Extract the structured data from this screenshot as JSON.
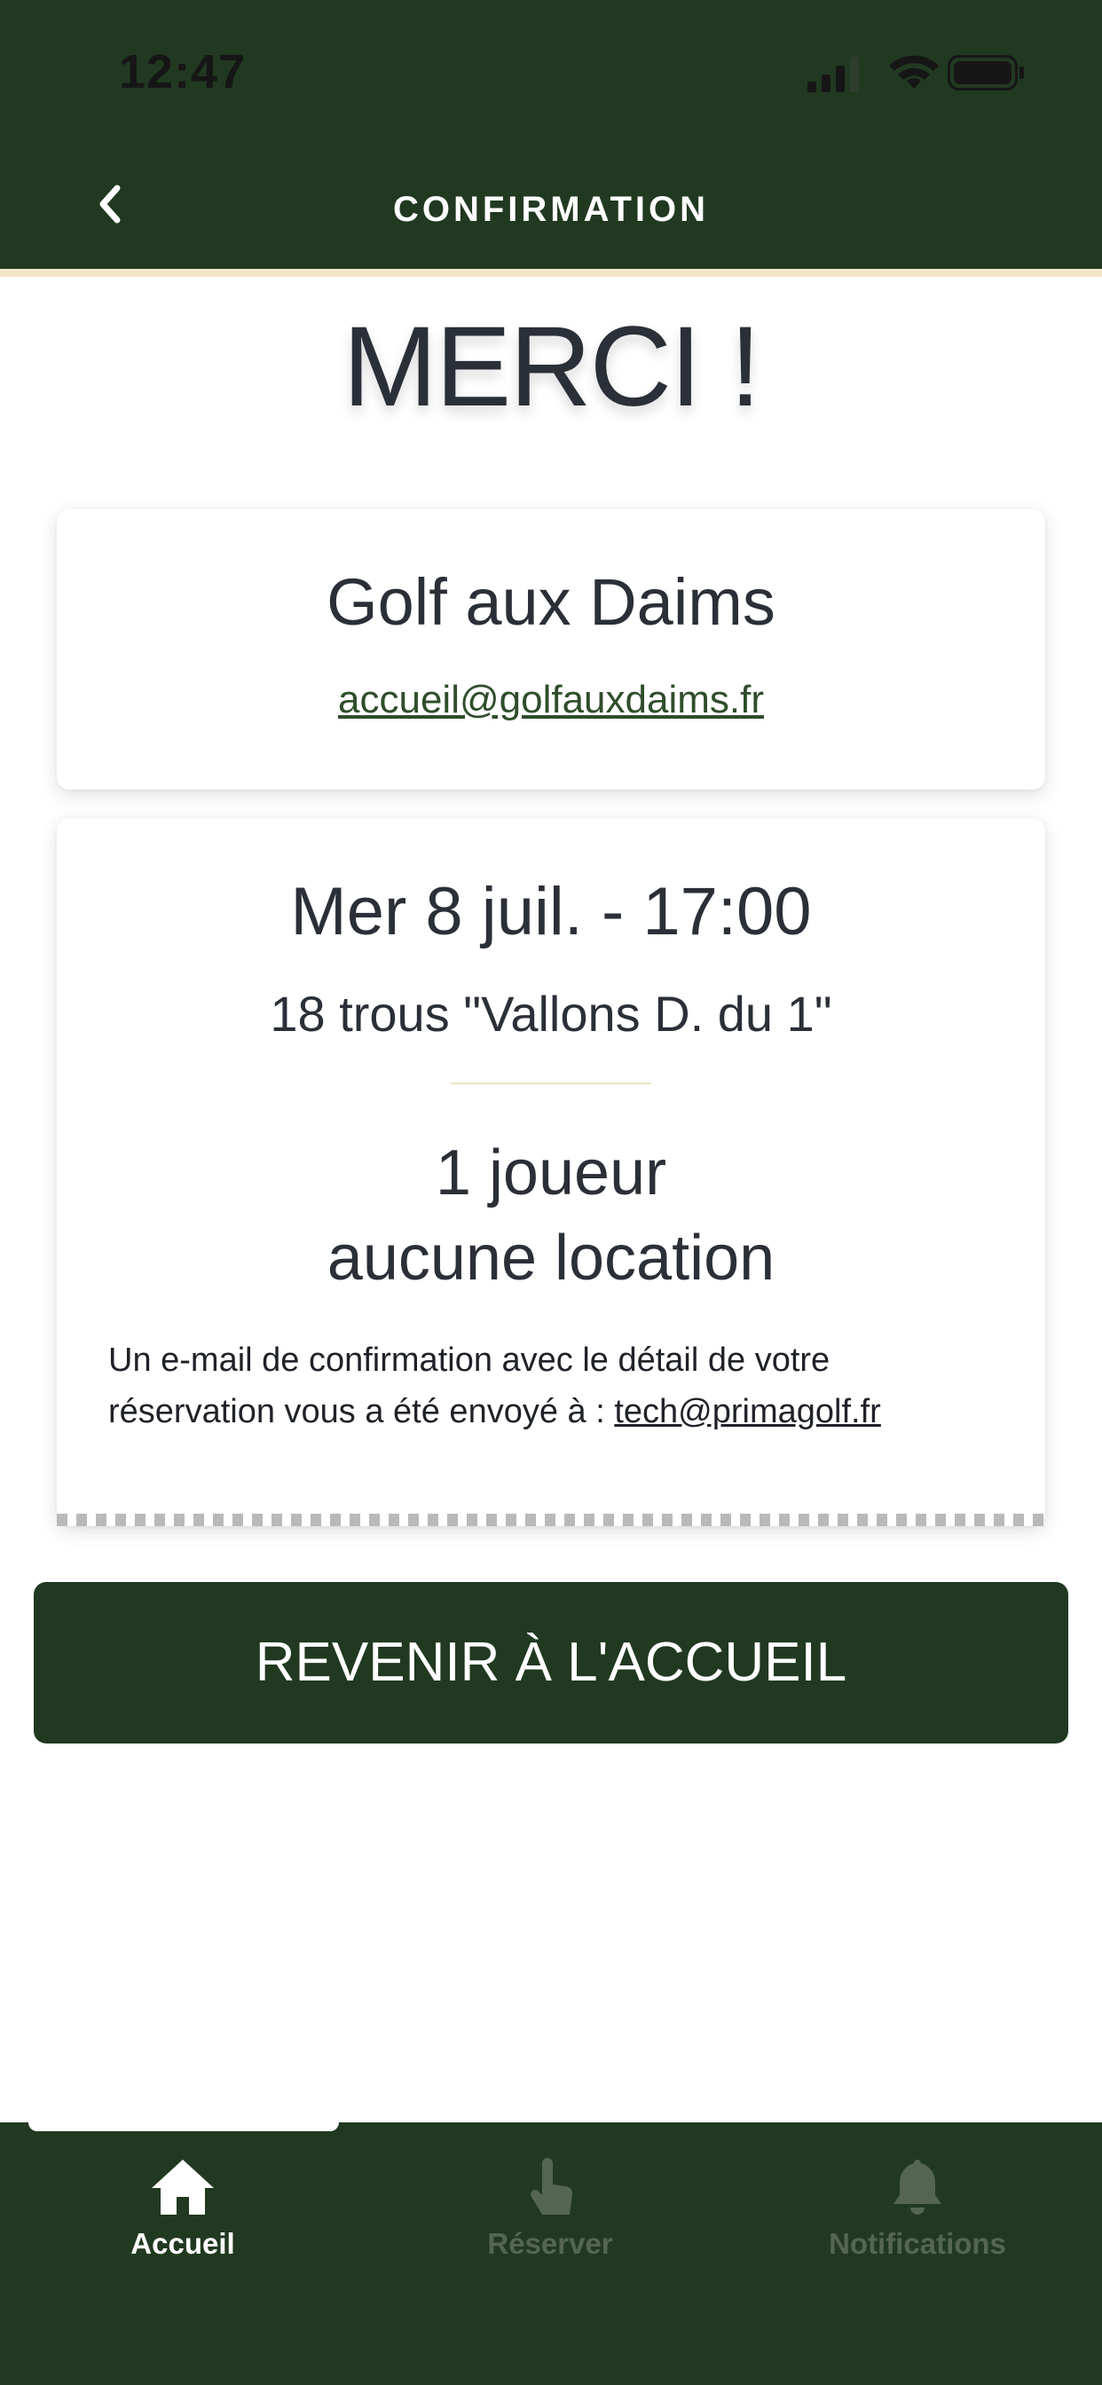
{
  "status_bar": {
    "time": "12:47",
    "icons": [
      "signal-icon",
      "wifi-icon",
      "battery-icon"
    ]
  },
  "header": {
    "back_icon": "chevron-left-icon",
    "title": "CONFIRMATION"
  },
  "main": {
    "thanks": "MERCI !",
    "club": {
      "name": "Golf aux Daims",
      "email": "accueil@golfauxdaims.fr"
    },
    "booking": {
      "date_time": "Mer 8 juil. - 17:00",
      "course": "18 trous \"Vallons D. du 1\"",
      "players": "1 joueur",
      "rental": "aucune location",
      "note_text": "Un e-mail de confirmation avec le détail de votre réservation vous a été envoyé à : ",
      "note_email": "tech@primagolf.fr"
    },
    "home_button": "REVENIR À L'ACCUEIL"
  },
  "tabbar": {
    "items": [
      {
        "label": "Accueil",
        "icon": "home-icon",
        "active": true
      },
      {
        "label": "Réserver",
        "icon": "tap-icon",
        "active": false
      },
      {
        "label": "Notifications",
        "icon": "bell-icon",
        "active": false
      }
    ]
  },
  "colors": {
    "header_bg": "#213920",
    "accent_line": "#f3e4c6",
    "button_bg": "#213920",
    "link": "#2f4d2b",
    "inactive_tab": "#54664f"
  }
}
